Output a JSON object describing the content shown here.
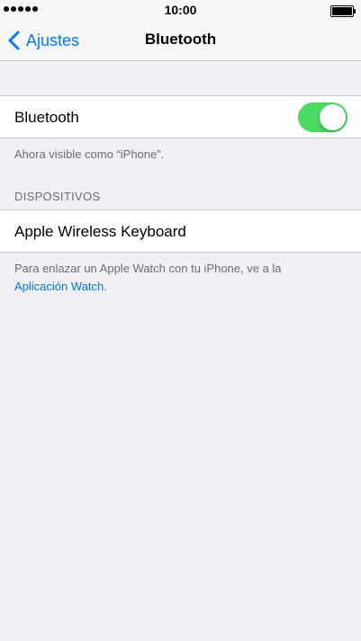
{
  "status_bar": {
    "time": "10:00",
    "signal_icon": "signal-dots-icon",
    "battery_icon": "battery-full-icon"
  },
  "nav": {
    "back_label": "Ajustes",
    "back_icon": "chevron-left-icon",
    "title": "Bluetooth"
  },
  "bluetooth_row": {
    "label": "Bluetooth",
    "toggle_on": true,
    "toggle_color": "#4cd964"
  },
  "visibility_note": "Ahora visible como “iPhone”.",
  "devices_section": {
    "header": "DISPOSITIVOS",
    "items": [
      {
        "name": "Apple Wireless Keyboard"
      }
    ]
  },
  "watch_note": {
    "text": "Para enlazar un Apple Watch con tu iPhone, ve a la",
    "link": "Aplicación Watch",
    "suffix": "."
  },
  "colors": {
    "accent": "#007aff",
    "background": "#efeff4"
  }
}
